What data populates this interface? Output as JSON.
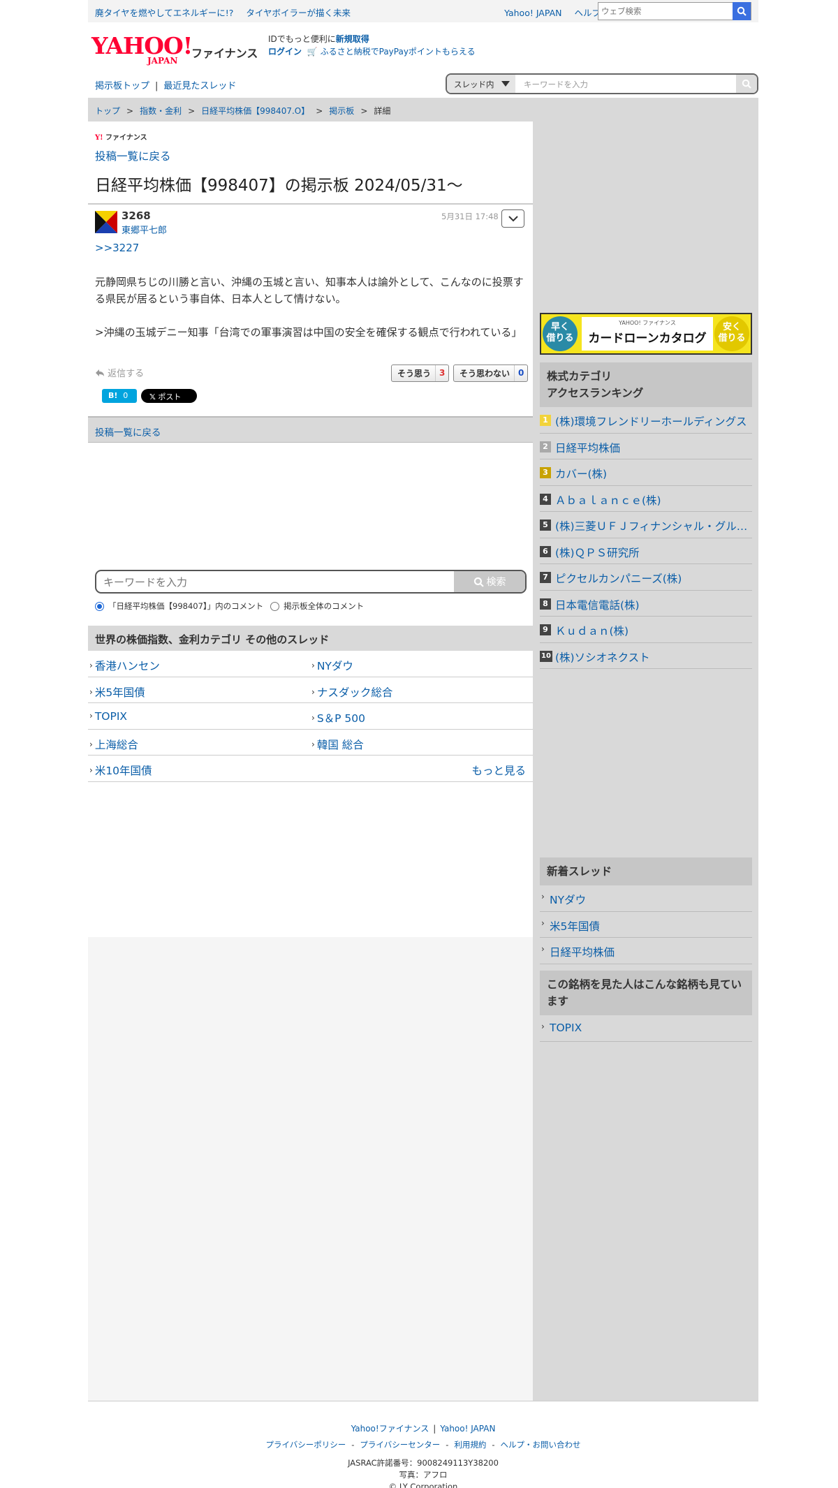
{
  "topbar": {
    "promo1": "廃タイヤを燃やしてエネルギーに!?",
    "promo2": "タイヤボイラーが描く未来",
    "yahoo_japan": "Yahoo! JAPAN",
    "help": "ヘルプ",
    "web_search_placeholder": "ウェブ検索"
  },
  "header": {
    "logo": "YAHOO!",
    "logo_sub": "JAPAN",
    "service": "ファイナンス",
    "id_prefix": "IDでもっと便利に",
    "signup": "新規取得",
    "login": "ログイン",
    "furusato": "ふるさと納税でPayPayポイントもらえる"
  },
  "boardnav": {
    "top": "掲示板トップ",
    "sep": "|",
    "recent": "最近見たスレッド",
    "scope": "スレッド内",
    "keyword_placeholder": "キーワードを入力"
  },
  "breadcrumb": {
    "items": [
      "トップ",
      "指数・金利",
      "日経平均株価【998407.O】",
      "掲示板",
      "詳細"
    ]
  },
  "thread": {
    "brand": "ファイナンス",
    "back": "投稿一覧に戻る",
    "title": "日経平均株価【998407】の掲示板 2024/05/31〜"
  },
  "post": {
    "number": "3268",
    "user": "東郷平七郎",
    "date": "5月31日 17:48",
    "anchor": ">>3227",
    "line1": "元静岡県ちじの川勝と言い、沖縄の玉城と言い、知事本人は論外として、こんなのに投票する県民が居るという事自体、日本人として情けない。",
    "line2": ">沖縄の玉城デニー知事「台湾での軍事演習は中国の安全を確保する観点で行われている」",
    "reply": "返信する",
    "agree_label": "そう思う",
    "agree_count": "3",
    "disagree_label": "そう思わない",
    "disagree_count": "0",
    "hatena_count": "0",
    "x_post": "ポスト"
  },
  "backbar": "投稿一覧に戻る",
  "search": {
    "placeholder": "キーワードを入力",
    "button": "検索",
    "radio1": "「日経平均株価【998407】」内のコメント",
    "radio2": "掲示板全体のコメント"
  },
  "category": {
    "title": "世界の株価指数、金利カテゴリ その他のスレッド",
    "items": [
      "香港ハンセン",
      "NYダウ",
      "米5年国債",
      "ナスダック総合",
      "TOPIX",
      "S＆P 500",
      "上海総合",
      "韓国 総合",
      "米10年国債"
    ],
    "more": "もっと見る"
  },
  "sidebar": {
    "ad": {
      "left": "早く\n借りる",
      "brand": "YAHOO! ファイナンス",
      "title": "カードローンカタログ",
      "right": "安く\n借りる"
    },
    "ranking_title1": "株式カテゴリ",
    "ranking_title2": "アクセスランキング",
    "ranking": [
      {
        "n": "1",
        "name": "(株)環境フレンドリーホールディングス"
      },
      {
        "n": "2",
        "name": "日経平均株価"
      },
      {
        "n": "3",
        "name": "カバー(株)"
      },
      {
        "n": "4",
        "name": "Ａｂａｌａｎｃｅ(株)"
      },
      {
        "n": "5",
        "name": "(株)三菱ＵＦＪフィナンシャル・グループ"
      },
      {
        "n": "6",
        "name": "(株)ＱＰＳ研究所"
      },
      {
        "n": "7",
        "name": "ピクセルカンパニーズ(株)"
      },
      {
        "n": "8",
        "name": "日本電信電話(株)"
      },
      {
        "n": "9",
        "name": "Ｋｕｄａｎ(株)"
      },
      {
        "n": "10",
        "name": "(株)ソシオネクスト"
      }
    ],
    "rank_colors": {
      "1": "#f2d33a",
      "2": "#a9a9a9",
      "3": "#c8a200",
      "other": "#444444"
    },
    "new_title": "新着スレッド",
    "new_threads": [
      "NYダウ",
      "米5年国債",
      "日経平均株価"
    ],
    "also_title": "この銘柄を見た人はこんな銘柄も見ています",
    "also": [
      "TOPIX"
    ]
  },
  "footer": {
    "finance": "Yahoo!ファイナンス",
    "sep": "|",
    "yahoo": "Yahoo! JAPAN",
    "links": [
      "プライバシーポリシー",
      "プライバシーセンター",
      "利用規約",
      "ヘルプ・お問い合わせ"
    ],
    "link_sep": "-",
    "jasrac": "JASRAC許諾番号：9008249113Y38200",
    "photo": "写真：アフロ",
    "copyright": "© LY Corporation"
  }
}
